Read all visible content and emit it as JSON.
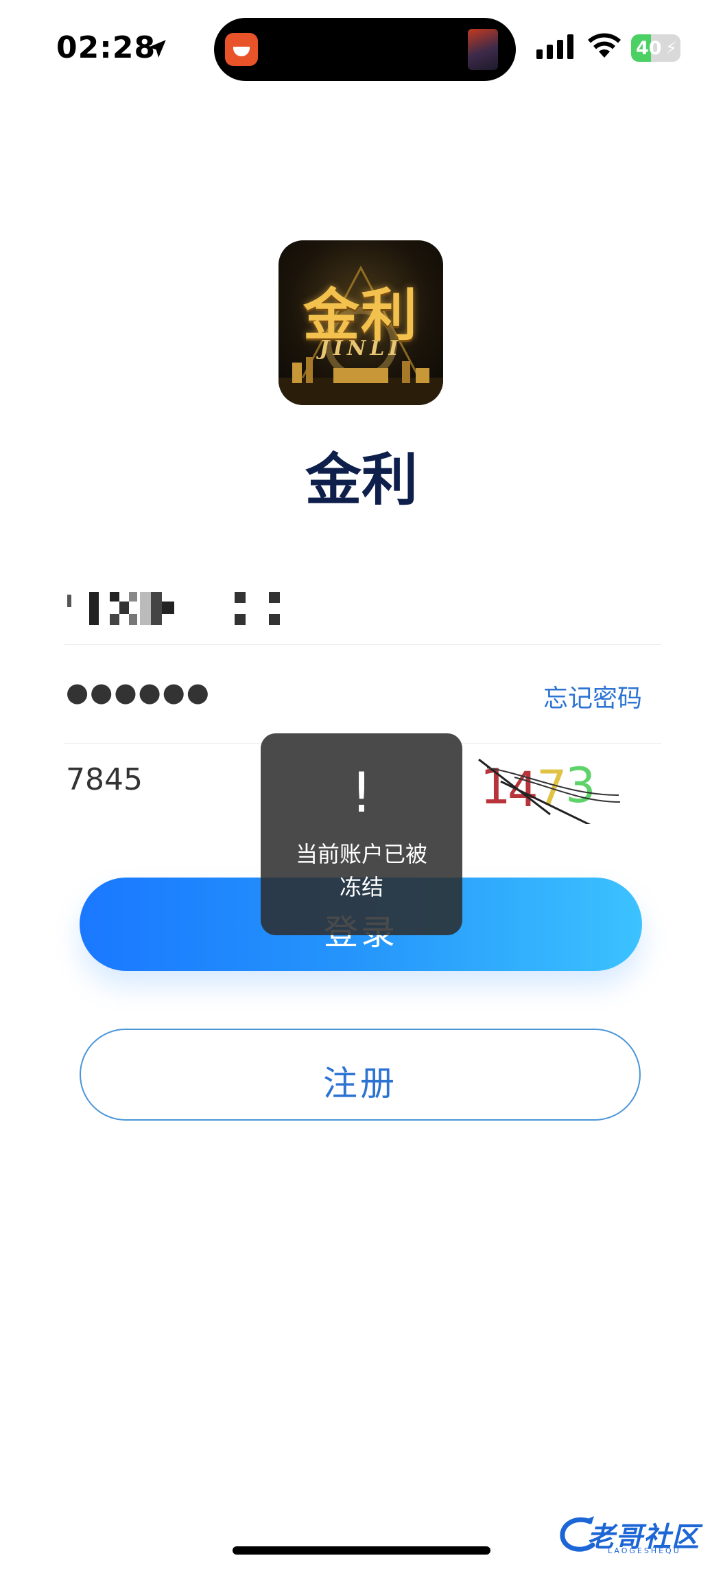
{
  "status_bar": {
    "time": "02:28",
    "battery_percent": "40",
    "battery_level": 0.4,
    "colors": {
      "battery_fill": "#4bd063"
    }
  },
  "app": {
    "logo_text": "金利",
    "logo_subtext": "JINLI",
    "name": "金利"
  },
  "form": {
    "password_mask": "●●●●●●",
    "forgot_password": "忘记密码",
    "captcha_input": "7845",
    "captcha_image_chars": [
      "1",
      "4",
      "7",
      "3"
    ],
    "captcha_colors": [
      "#b7343a",
      "#b7343a",
      "#e0c244",
      "#5fd36a"
    ]
  },
  "buttons": {
    "login": "登录",
    "register": "注册"
  },
  "toast": {
    "icon": "!",
    "message": "当前账户已被冻结"
  },
  "watermark": {
    "text": "老哥社区",
    "subtext": "LAOGESHEQU"
  }
}
